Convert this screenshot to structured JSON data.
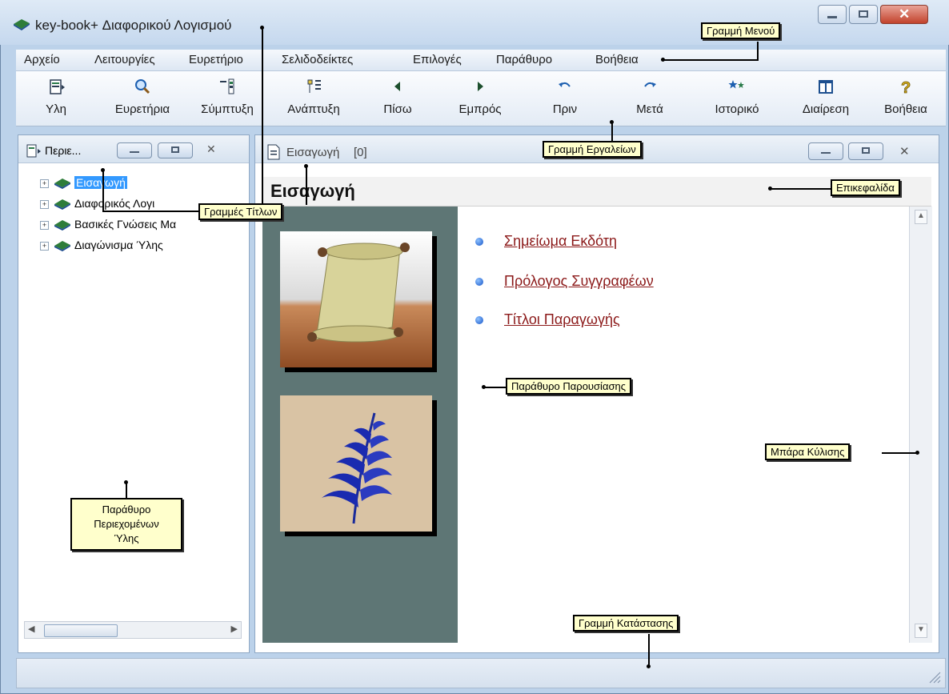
{
  "window": {
    "title": "key-book+  Διαφορικού Λογισμού"
  },
  "menu": {
    "items": [
      "Αρχείο",
      "Λειτουργίες",
      "Ευρετήριο",
      "Σελιδοδείκτες",
      "Επιλογές",
      "Παράθυρο",
      "Βοήθεια"
    ]
  },
  "toolbar": {
    "buttons": [
      {
        "label": "Υλη",
        "icon": "material-icon"
      },
      {
        "label": "Ευρετήρια",
        "icon": "magnifier-icon"
      },
      {
        "label": "Σύμπτυξη",
        "icon": "collapse-icon"
      },
      {
        "label": "Ανάπτυξη",
        "icon": "expand-icon"
      },
      {
        "label": "Πίσω",
        "icon": "back-arrow-icon"
      },
      {
        "label": "Εμπρός",
        "icon": "forward-arrow-icon"
      },
      {
        "label": "Πριν",
        "icon": "undo-icon"
      },
      {
        "label": "Μετά",
        "icon": "redo-icon"
      },
      {
        "label": "Ιστορικό",
        "icon": "history-icon"
      },
      {
        "label": "Διαίρεση",
        "icon": "split-icon"
      },
      {
        "label": "Βοήθεια",
        "icon": "help-icon"
      }
    ]
  },
  "contents_panel": {
    "title": "Περιε...",
    "tree": [
      {
        "label": "Εισαγωγή",
        "selected": true
      },
      {
        "label": "Διαφορικός Λογι"
      },
      {
        "label": "Βασικές Γνώσεις Μα"
      },
      {
        "label": "Διαγώνισμα Ύλης"
      }
    ]
  },
  "document_window": {
    "title": "Εισαγωγή",
    "count": "[0]",
    "header": "Εισαγωγή",
    "links": [
      "Σημείωμα Εκδότη",
      "Πρόλογος Συγγραφέων",
      "Τίτλοι Παραγωγής"
    ]
  },
  "callouts": {
    "menu_bar": "Γραμμή Μενού",
    "toolbar": "Γραμμή Εργαλείων",
    "title_bars": "Γραμμές Τίτλων",
    "header": "Επικεφαλίδα",
    "presentation": "Παράθυρο Παρουσίασης",
    "scrollbar": "Μπάρα Κύλισης",
    "contents_line1": "Παράθυρο",
    "contents_line2": "Περιεχομένων",
    "contents_line3": "Ύλης",
    "status_bar": "Γραμμή Κατάστασης"
  },
  "colors": {
    "accent": "#3399ff",
    "link": "#8c1a1a",
    "callout_bg": "#ffffcc",
    "strip": "#5e7675"
  }
}
